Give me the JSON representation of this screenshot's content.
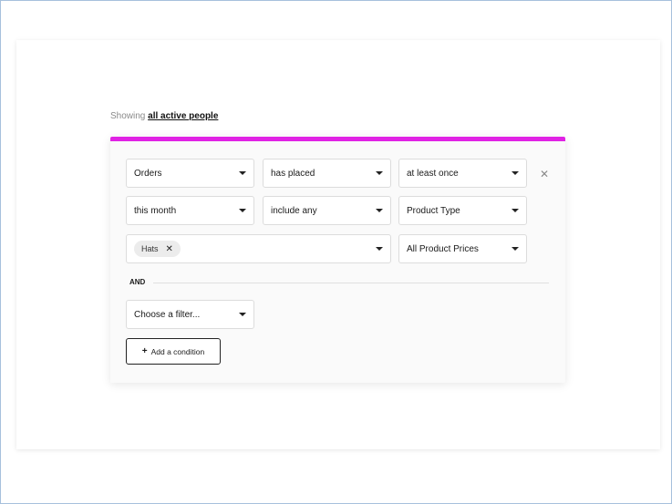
{
  "header": {
    "showing_prefix": "Showing",
    "audience_link": "all active people"
  },
  "condition": {
    "row1": {
      "metric": "Orders",
      "action": "has placed",
      "frequency": "at least once"
    },
    "row2": {
      "period": "this month",
      "match": "include any",
      "property": "Product Type"
    },
    "row3": {
      "selected_tags": [
        "Hats"
      ],
      "price_filter": "All Product Prices"
    },
    "remove_icon": "close-icon"
  },
  "logic": {
    "and_label": "AND",
    "choose_filter": "Choose a filter...",
    "add_condition": "Add a condition",
    "add_icon_glyph": "+"
  },
  "colors": {
    "accent": "#e022e4"
  }
}
